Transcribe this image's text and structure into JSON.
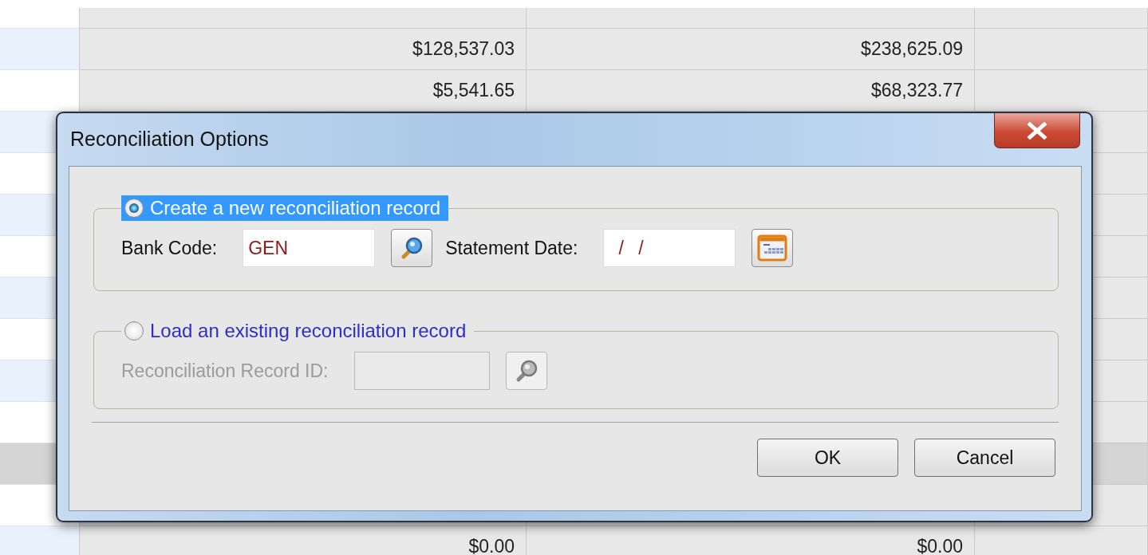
{
  "table": {
    "rows": [
      {
        "selected": false,
        "column_2": "$128,537.03",
        "column_3": "$238,625.09"
      },
      {
        "selected": false,
        "column_2": "$5,541.65",
        "column_3": "$68,323.77"
      },
      {
        "selected": false
      },
      {
        "selected": false
      },
      {
        "selected": false
      },
      {
        "selected": false
      },
      {
        "selected": false
      },
      {
        "selected": false
      },
      {
        "selected": false
      },
      {
        "selected": false
      },
      {
        "selected": true
      },
      {
        "selected": false
      },
      {
        "selected": false,
        "column_2": "$0.00",
        "column_3": "$0.00"
      }
    ]
  },
  "dialog": {
    "title": "Reconciliation Options",
    "options": [
      {
        "label": "Create a new reconciliation record",
        "selected": true,
        "fields": [
          {
            "kind": "lookup",
            "label": "Bank Code:",
            "value": "GEN"
          },
          {
            "kind": "date",
            "label": "Statement Date:",
            "value": "/ /"
          }
        ]
      },
      {
        "label": "Load an existing reconciliation record",
        "selected": false,
        "fields": [
          {
            "kind": "lookup",
            "label": "Reconciliation Record ID:"
          }
        ]
      }
    ],
    "buttons": [
      "OK",
      "Cancel"
    ]
  }
}
